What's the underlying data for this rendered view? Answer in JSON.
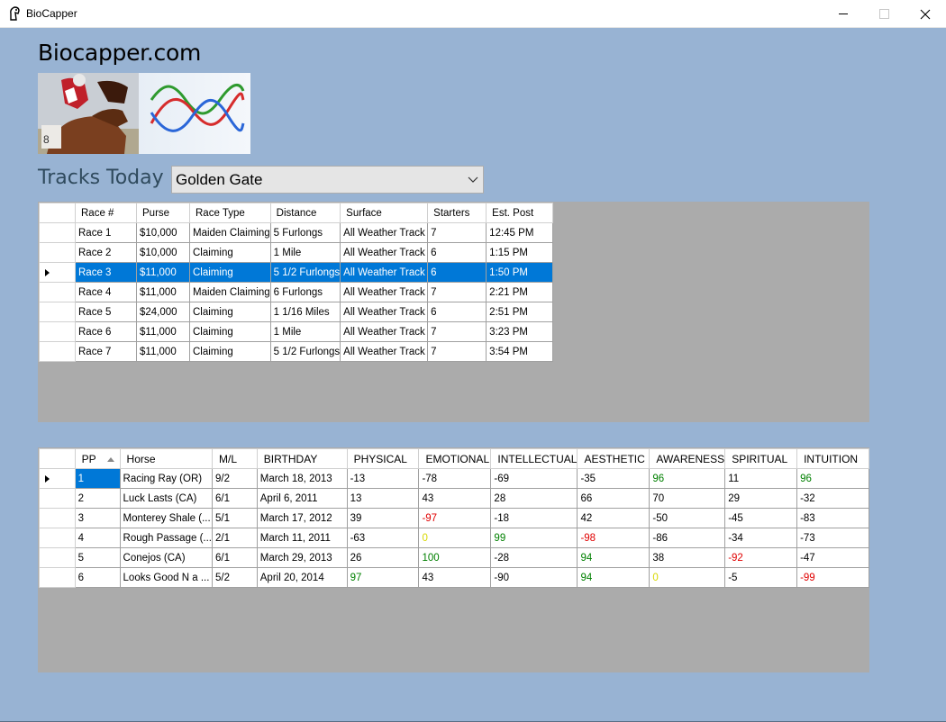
{
  "window": {
    "title": "BioCapper",
    "icon": "horse-head-icon"
  },
  "brand": {
    "title": "Biocapper.com",
    "banner_image": "jockey-and-biorhythm-waves-logo",
    "wave_colors": [
      "#2e9a2e",
      "#d62c2c",
      "#2a66d8"
    ]
  },
  "tracks": {
    "label": "Tracks Today",
    "selected": "Golden Gate"
  },
  "races": {
    "columns": [
      "Race #",
      "Purse",
      "Race Type",
      "Distance",
      "Surface",
      "Starters",
      "Est. Post"
    ],
    "selected_index": 2,
    "rows": [
      [
        "Race 1",
        "$10,000",
        "Maiden Claiming",
        "5 Furlongs",
        "All Weather Track",
        "7",
        "12:45 PM"
      ],
      [
        "Race 2",
        "$10,000",
        "Claiming",
        "1 Mile",
        "All Weather Track",
        "6",
        "1:15 PM"
      ],
      [
        "Race 3",
        "$11,000",
        "Claiming",
        "5 1/2 Furlongs",
        "All Weather Track",
        "6",
        "1:50 PM"
      ],
      [
        "Race 4",
        "$11,000",
        "Maiden Claiming",
        "6 Furlongs",
        "All Weather Track",
        "7",
        "2:21 PM"
      ],
      [
        "Race 5",
        "$24,000",
        "Claiming",
        "1 1/16 Miles",
        "All Weather Track",
        "6",
        "2:51 PM"
      ],
      [
        "Race 6",
        "$11,000",
        "Claiming",
        "1 Mile",
        "All Weather Track",
        "7",
        "3:23 PM"
      ],
      [
        "Race 7",
        "$11,000",
        "Claiming",
        "5 1/2 Furlongs",
        "All Weather Track",
        "7",
        "3:54 PM"
      ]
    ]
  },
  "horses": {
    "columns": [
      "PP",
      "Horse",
      "M/L",
      "BIRTHDAY",
      "PHYSICAL",
      "EMOTIONAL",
      "INTELLECTUAL",
      "AESTHETIC",
      "AWARENESS",
      "SPIRITUAL",
      "INTUITION"
    ],
    "sorted_column": "PP",
    "current_row": 0,
    "colors": {
      "green": "#008000",
      "red": "#e00000",
      "yellow": "#d8d800"
    },
    "rows": [
      {
        "cells": [
          "1",
          "Racing Ray (OR)",
          "9/2",
          "March 18, 2013",
          "-13",
          "-78",
          "-69",
          "-35",
          "96",
          "11",
          "96"
        ],
        "tones": [
          "",
          "",
          "",
          "",
          "",
          "",
          "",
          "",
          "green",
          "",
          "green"
        ]
      },
      {
        "cells": [
          "2",
          "Luck Lasts (CA)",
          "6/1",
          "April 6, 2011",
          "13",
          "43",
          "28",
          "66",
          "70",
          "29",
          "-32"
        ],
        "tones": [
          "",
          "",
          "",
          "",
          "",
          "",
          "",
          "",
          "",
          "",
          ""
        ]
      },
      {
        "cells": [
          "3",
          "Monterey Shale (...",
          "5/1",
          "March 17, 2012",
          "39",
          "-97",
          "-18",
          "42",
          "-50",
          "-45",
          "-83"
        ],
        "tones": [
          "",
          "",
          "",
          "",
          "",
          "red",
          "",
          "",
          "",
          "",
          ""
        ]
      },
      {
        "cells": [
          "4",
          "Rough Passage (...",
          "2/1",
          "March 11, 2011",
          "-63",
          "0",
          "99",
          "-98",
          "-86",
          "-34",
          "-73"
        ],
        "tones": [
          "",
          "",
          "",
          "",
          "",
          "yellow",
          "green",
          "red",
          "",
          "",
          ""
        ]
      },
      {
        "cells": [
          "5",
          "Conejos (CA)",
          "6/1",
          "March 29, 2013",
          "26",
          "100",
          "-28",
          "94",
          "38",
          "-92",
          "-47"
        ],
        "tones": [
          "",
          "",
          "",
          "",
          "",
          "green",
          "",
          "green",
          "",
          "red",
          ""
        ]
      },
      {
        "cells": [
          "6",
          "Looks Good N a ...",
          "5/2",
          "April 20, 2014",
          "97",
          "43",
          "-90",
          "94",
          "0",
          "-5",
          "-99"
        ],
        "tones": [
          "",
          "",
          "",
          "",
          "green",
          "",
          "",
          "green",
          "yellow",
          "",
          "red"
        ]
      }
    ]
  }
}
